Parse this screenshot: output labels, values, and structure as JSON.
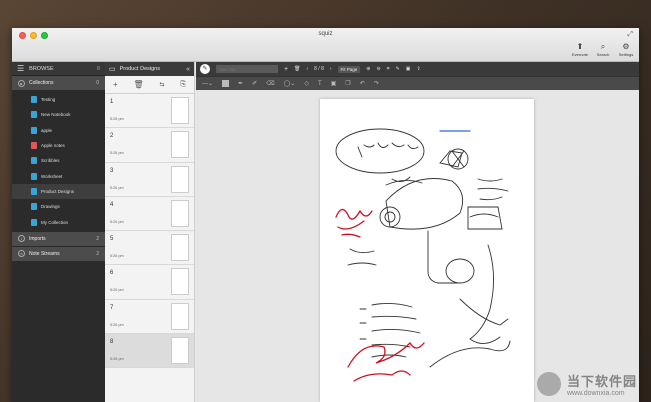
{
  "window": {
    "title": "squiz"
  },
  "top_actions": [
    {
      "label": "Evernote",
      "icon": "evernote-icon",
      "glyph": "⬆"
    },
    {
      "label": "Search",
      "icon": "search-icon",
      "glyph": "⌕"
    },
    {
      "label": "Settings",
      "icon": "gear-icon",
      "glyph": "⚙"
    }
  ],
  "browse": {
    "title": "BROWSE",
    "count": "8",
    "collections": {
      "label": "Collections",
      "count": "0"
    },
    "items": [
      {
        "label": "Testing",
        "color": "#3aa3d8"
      },
      {
        "label": "New Notebook",
        "color": "#3aa3d8"
      },
      {
        "label": "apple",
        "color": "#3aa3d8"
      },
      {
        "label": "Apple notes",
        "color": "#e0565b"
      },
      {
        "label": "Scribbles",
        "color": "#3aa3d8"
      },
      {
        "label": "Worksheet",
        "color": "#3aa3d8"
      },
      {
        "label": "Product Designs",
        "color": "#3aa3d8"
      },
      {
        "label": "Drawings",
        "color": "#3aa3d8"
      },
      {
        "label": "My Collection",
        "color": "#3aa3d8"
      }
    ],
    "imports": {
      "label": "Imports",
      "count": "2"
    },
    "streams": {
      "label": "Note Streams",
      "count": "2"
    }
  },
  "notes": {
    "notebook": "Product Designs",
    "items": [
      {
        "num": "1",
        "time": "5:26 pm"
      },
      {
        "num": "2",
        "time": "5:26 pm"
      },
      {
        "num": "3",
        "time": "5:26 pm"
      },
      {
        "num": "4",
        "time": "5:26 pm"
      },
      {
        "num": "5",
        "time": "5:26 pm"
      },
      {
        "num": "6",
        "time": "5:26 pm"
      },
      {
        "num": "7",
        "time": "5:26 pm"
      },
      {
        "num": "8",
        "time": "5:26 pm"
      }
    ]
  },
  "editor": {
    "title_placeholder": "Note Title",
    "page_counter": "8 / 8",
    "fit_label": "Fit Page"
  },
  "sketch": {
    "text_headphones": "headphones",
    "text_hardware": "hardware",
    "text_wood": "wood body",
    "text_continue": "Continue later",
    "ink_color": "#cc1122"
  },
  "watermark": {
    "cn": "当下软件园",
    "url": "www.downxia.com"
  }
}
